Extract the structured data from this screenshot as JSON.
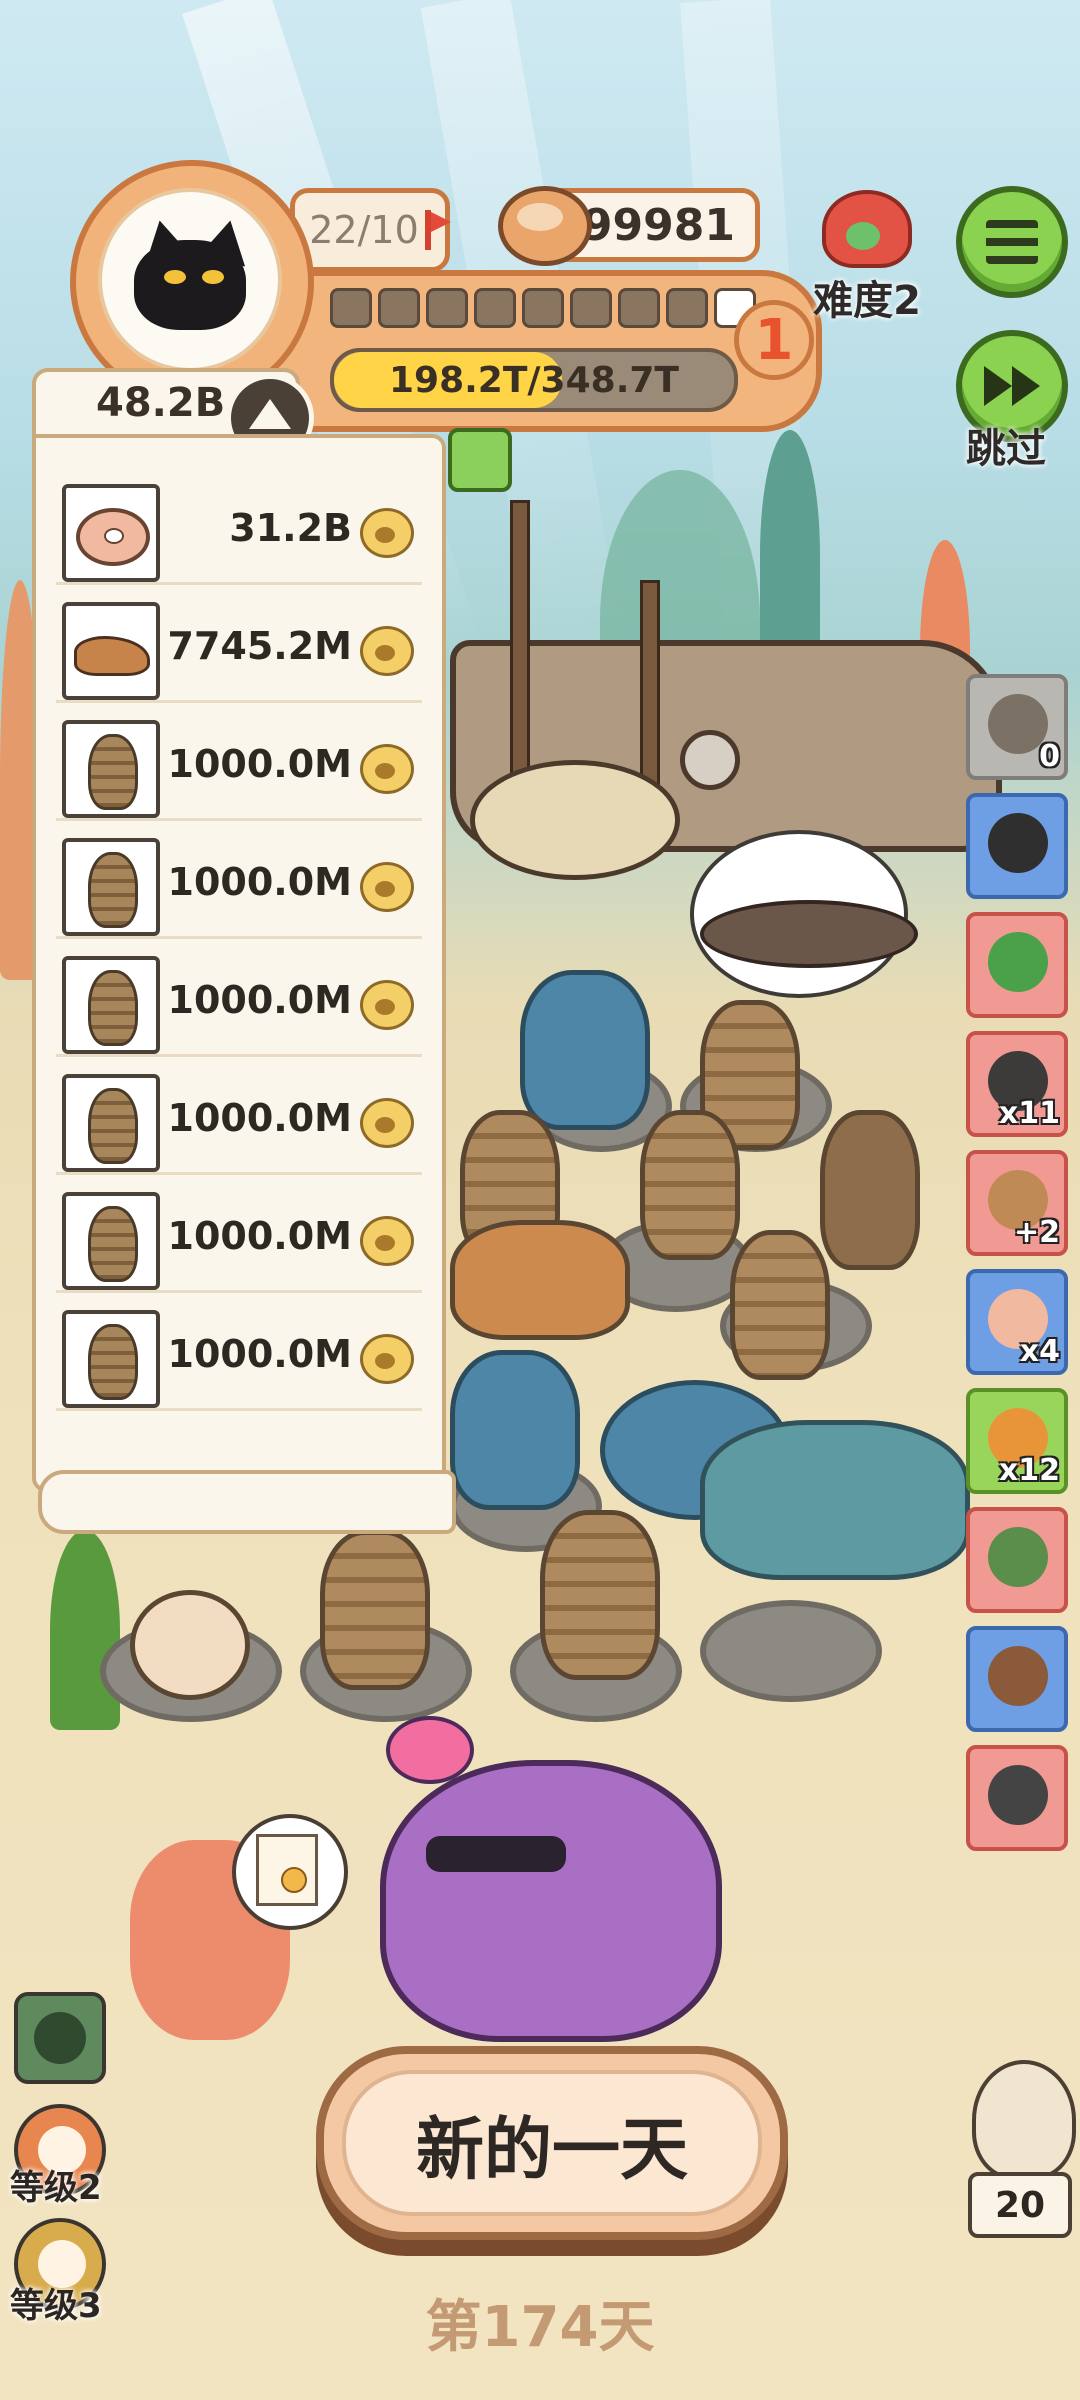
{
  "hud": {
    "flags": "22/10",
    "coins": "99981",
    "level": "1",
    "segments_total": 9,
    "segments_filled": 1,
    "exp_text": "198.2T/348.7T",
    "exp_fraction": 0.57
  },
  "difficulty": {
    "label": "难度2"
  },
  "skip": {
    "label": "跳过"
  },
  "panel": {
    "total": "48.2B",
    "rows": [
      {
        "thumb": "donut-icon",
        "value": "31.2B"
      },
      {
        "thumb": "dinosaur-icon",
        "value": "7745.2M"
      },
      {
        "thumb": "bug-icon",
        "value": "1000.0M"
      },
      {
        "thumb": "bug-icon",
        "value": "1000.0M"
      },
      {
        "thumb": "bug-icon",
        "value": "1000.0M"
      },
      {
        "thumb": "bug-icon",
        "value": "1000.0M"
      },
      {
        "thumb": "bug-icon",
        "value": "1000.0M"
      },
      {
        "thumb": "bug-icon",
        "value": "1000.0M"
      }
    ]
  },
  "side_items": [
    {
      "name": "side-item-egg-nest",
      "style": "grey",
      "color": "#7b7164",
      "count": "0"
    },
    {
      "name": "side-item-camera",
      "style": "blue",
      "color": "#2f2f2f",
      "count": ""
    },
    {
      "name": "side-item-green-slime",
      "style": "red",
      "color": "#4aa14a",
      "count": ""
    },
    {
      "name": "side-item-gear-bag",
      "style": "red",
      "color": "#3c3b39",
      "count": "x11"
    },
    {
      "name": "side-item-cookie",
      "style": "red",
      "color": "#c08a57",
      "count": "+2"
    },
    {
      "name": "side-item-donut",
      "style": "blue",
      "color": "#f1b9a0",
      "count": "x4"
    },
    {
      "name": "side-item-ticket",
      "style": "green",
      "color": "#e8953a",
      "count": "x12"
    },
    {
      "name": "side-item-rock-slime",
      "style": "red",
      "color": "#5a8e4a",
      "count": ""
    },
    {
      "name": "side-item-frame",
      "style": "blue",
      "color": "#8b5a3a",
      "count": ""
    },
    {
      "name": "side-item-fossil",
      "style": "red",
      "color": "#444",
      "count": ""
    }
  ],
  "bottom_left": {
    "grade2": "等级2",
    "grade3": "等级3"
  },
  "new_day": {
    "label": "新的一天"
  },
  "day": {
    "label": "第174天"
  },
  "owl": {
    "count": "20"
  }
}
